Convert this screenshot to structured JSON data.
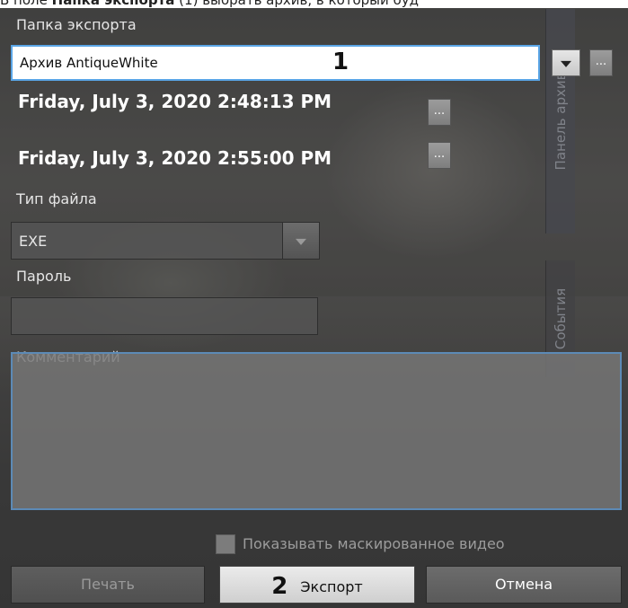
{
  "doc_caption": {
    "prefix": "В поле ",
    "bold": "Папка экспорта",
    "suffix": " (1) выбрать архив, в который буд"
  },
  "side_tabs": {
    "archive_panel": "Панель архив",
    "events": "События"
  },
  "export_folder": {
    "label": "Папка экспорта",
    "value": "Архив AntiqueWhite",
    "marker": "1",
    "browse": "..."
  },
  "time_range": {
    "start": "Friday, July 3, 2020 2:48:13 PM",
    "end": "Friday, July 3, 2020 2:55:00 PM",
    "start_button": "...",
    "end_button": "..."
  },
  "file_type": {
    "label": "Тип файла",
    "value": "EXE"
  },
  "password": {
    "label": "Пароль",
    "value": ""
  },
  "comment": {
    "label": "Комментарий",
    "value": ""
  },
  "show_masked": {
    "label": "Показывать маскированное видео",
    "checked": false
  },
  "buttons": {
    "print": "Печать",
    "export": "Экспорт",
    "export_marker": "2",
    "cancel": "Отмена"
  }
}
